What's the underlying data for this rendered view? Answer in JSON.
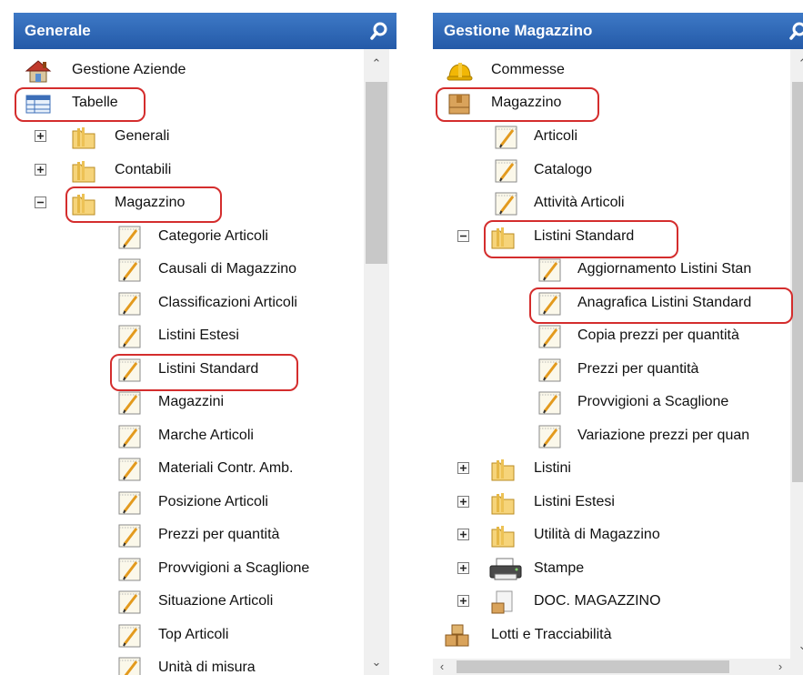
{
  "left_panel": {
    "title": "Generale",
    "items": [
      {
        "label": "Gestione Aziende"
      },
      {
        "label": "Tabelle"
      },
      {
        "label": "Generali",
        "expander": "+"
      },
      {
        "label": "Contabili",
        "expander": "+"
      },
      {
        "label": "Magazzino",
        "expander": "-"
      },
      {
        "label": "Categorie Articoli"
      },
      {
        "label": "Causali di Magazzino"
      },
      {
        "label": "Classificazioni Articoli"
      },
      {
        "label": "Listini Estesi"
      },
      {
        "label": "Listini Standard"
      },
      {
        "label": "Magazzini"
      },
      {
        "label": "Marche Articoli"
      },
      {
        "label": "Materiali Contr. Amb."
      },
      {
        "label": "Posizione Articoli"
      },
      {
        "label": "Prezzi per quantità"
      },
      {
        "label": "Provvigioni a Scaglione"
      },
      {
        "label": "Situazione Articoli"
      },
      {
        "label": "Top Articoli"
      },
      {
        "label": "Unità di misura"
      }
    ]
  },
  "right_panel": {
    "title": "Gestione Magazzino",
    "items": [
      {
        "label": "Commesse"
      },
      {
        "label": "Magazzino"
      },
      {
        "label": "Articoli"
      },
      {
        "label": "Catalogo"
      },
      {
        "label": "Attività Articoli"
      },
      {
        "label": "Listini Standard",
        "expander": "-"
      },
      {
        "label": "Aggiornamento Listini Stan"
      },
      {
        "label": "Anagrafica Listini Standard"
      },
      {
        "label": "Copia prezzi per quantità"
      },
      {
        "label": "Prezzi per quantità"
      },
      {
        "label": "Provvigioni a Scaglione"
      },
      {
        "label": "Variazione prezzi per quan"
      },
      {
        "label": "Listini",
        "expander": "+"
      },
      {
        "label": "Listini Estesi",
        "expander": "+"
      },
      {
        "label": "Utilità di Magazzino",
        "expander": "+"
      },
      {
        "label": "Stampe",
        "expander": "+"
      },
      {
        "label": "DOC. MAGAZZINO",
        "expander": "+"
      },
      {
        "label": "Lotti e Tracciabilità"
      }
    ]
  },
  "icons": {
    "search": "magnifier-icon",
    "home": "house-icon",
    "table": "table-icon",
    "folder": "folder-icon",
    "form": "notepad-pencil-icon",
    "hardhat": "hardhat-icon",
    "box": "box-icon",
    "printer": "printer-icon",
    "doc": "document-icon",
    "boxes": "boxes-icon"
  },
  "colors": {
    "header_bg": "#2f66b4",
    "highlight": "#d42d2d"
  }
}
